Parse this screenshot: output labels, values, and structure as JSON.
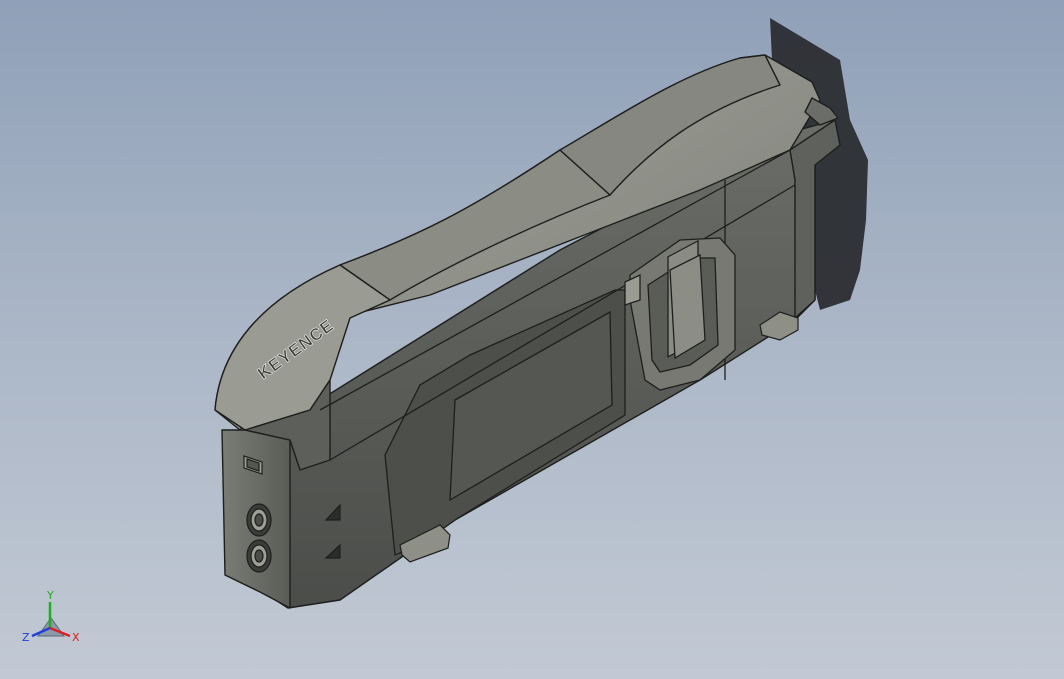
{
  "model": {
    "brand_text": "KEYENCE"
  },
  "triad": {
    "x_label": "X",
    "y_label": "Y",
    "z_label": "Z",
    "x_color": "#e02020",
    "y_color": "#19b019",
    "z_color": "#2040e0"
  },
  "colors": {
    "body_dark": "#545652",
    "body_mid": "#6e706a",
    "body_light": "#8f918a",
    "top_highlight": "#a7a89f",
    "edge": "#1e1f1d",
    "shadow": "#2a2c30"
  }
}
